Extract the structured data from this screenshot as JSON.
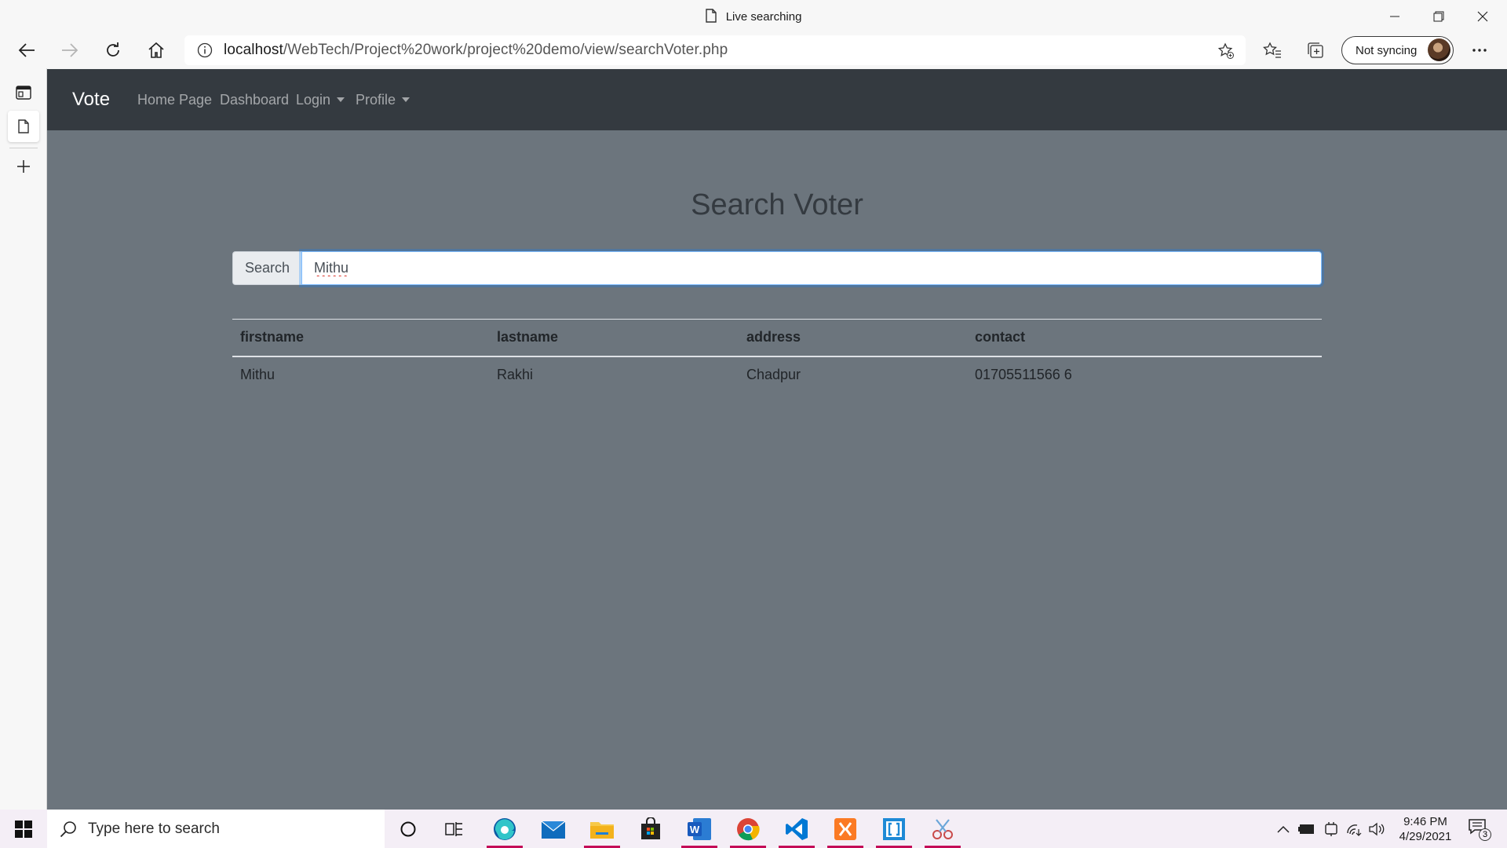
{
  "window": {
    "title": "Live searching"
  },
  "browser": {
    "url_host": "localhost",
    "url_path": "/WebTech/Project%20work/project%20demo/view/searchVoter.php",
    "sync_label": "Not syncing"
  },
  "site": {
    "brand": "Vote",
    "nav": {
      "home": "Home Page",
      "dashboard": "Dashboard",
      "login": "Login",
      "profile": "Profile"
    },
    "page_title": "Search Voter",
    "search": {
      "addon_label": "Search",
      "value": "Mithu"
    },
    "table": {
      "headers": [
        "firstname",
        "lastname",
        "address",
        "contact"
      ],
      "rows": [
        [
          "Mithu",
          "Rakhi",
          "Chadpur",
          "01705511566 6"
        ]
      ]
    }
  },
  "taskbar": {
    "search_placeholder": "Type here to search",
    "time": "9:46 PM",
    "date": "4/29/2021",
    "notification_count": "3",
    "apps": [
      "cortana-icon",
      "task-view-icon",
      "edge-icon",
      "mail-icon",
      "file-explorer-icon",
      "store-icon",
      "word-icon",
      "chrome-icon",
      "vscode-icon",
      "xampp-icon",
      "brackets-icon",
      "snip-sketch-icon"
    ]
  },
  "colors": {
    "navbar": "#343a40",
    "page_bg": "#6c757d",
    "taskbar_accent": "#c40b57"
  }
}
